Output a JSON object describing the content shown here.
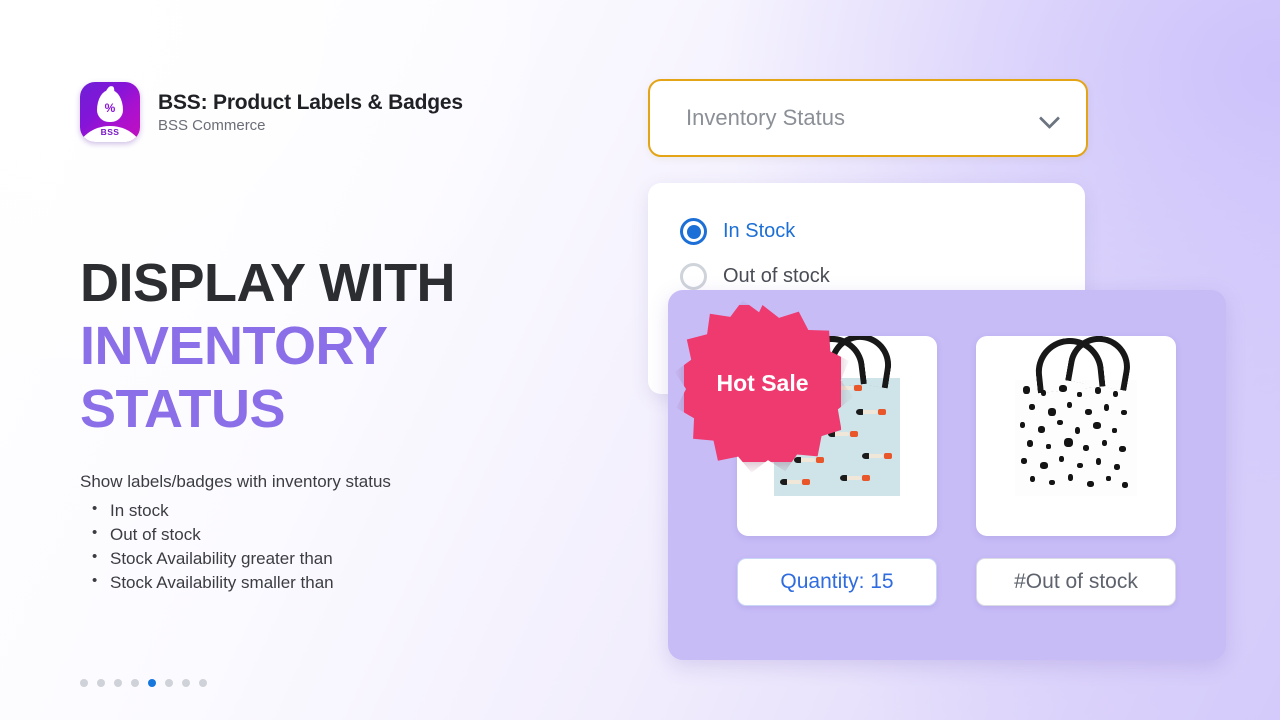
{
  "brand": {
    "app_name": "BSS: Product Labels & Badges",
    "vendor": "BSS Commerce",
    "logo_icon": "flame-percent-icon",
    "logo_wordmark": "BSS",
    "logo_percent": "%",
    "colors": {
      "logo_start": "#6d1fd6",
      "logo_end": "#c40fbe",
      "wordmark": "#7a14c9"
    }
  },
  "headline": {
    "line1": "DISPLAY WITH",
    "line2": "INVENTORY",
    "line3": "STATUS",
    "colors": {
      "dark": "#2b2d31",
      "accent": "#8b6fe8"
    }
  },
  "description": {
    "lead": "Show labels/badges with inventory status",
    "bullets": [
      "In stock",
      "Out of stock",
      "Stock Availability greater than",
      "Stock Availability smaller than"
    ]
  },
  "pagination": {
    "total": 8,
    "active_index": 5,
    "active_color": "#1677dd",
    "inactive_color": "#cfd2d8"
  },
  "dropdown": {
    "placeholder": "Inventory Status",
    "selected_value": "",
    "chevron_icon": "chevron-down-icon",
    "border_color": "#e3a416"
  },
  "radio_group": {
    "options": [
      {
        "label": "In Stock",
        "selected": true
      },
      {
        "label": "Out of stock",
        "selected": false
      }
    ],
    "selected_color": "#1c6fd6",
    "unselected_color": "#4a4d55"
  },
  "showcase": {
    "background_color": "#c8bcf7",
    "badge": {
      "text": "Hot Sale",
      "shape": "starburst",
      "color": "#ef3a6f",
      "text_color": "#ffffff"
    },
    "products": [
      {
        "image_alt": "light-blue-tote-bag-swimmers-pattern",
        "label": "Quantity: 15",
        "label_style": "blue",
        "label_color": "#2f6ce0"
      },
      {
        "image_alt": "white-tote-bag-black-dots-pattern",
        "label": "#Out of stock",
        "label_style": "grey",
        "label_color": "#5e636d"
      }
    ]
  }
}
